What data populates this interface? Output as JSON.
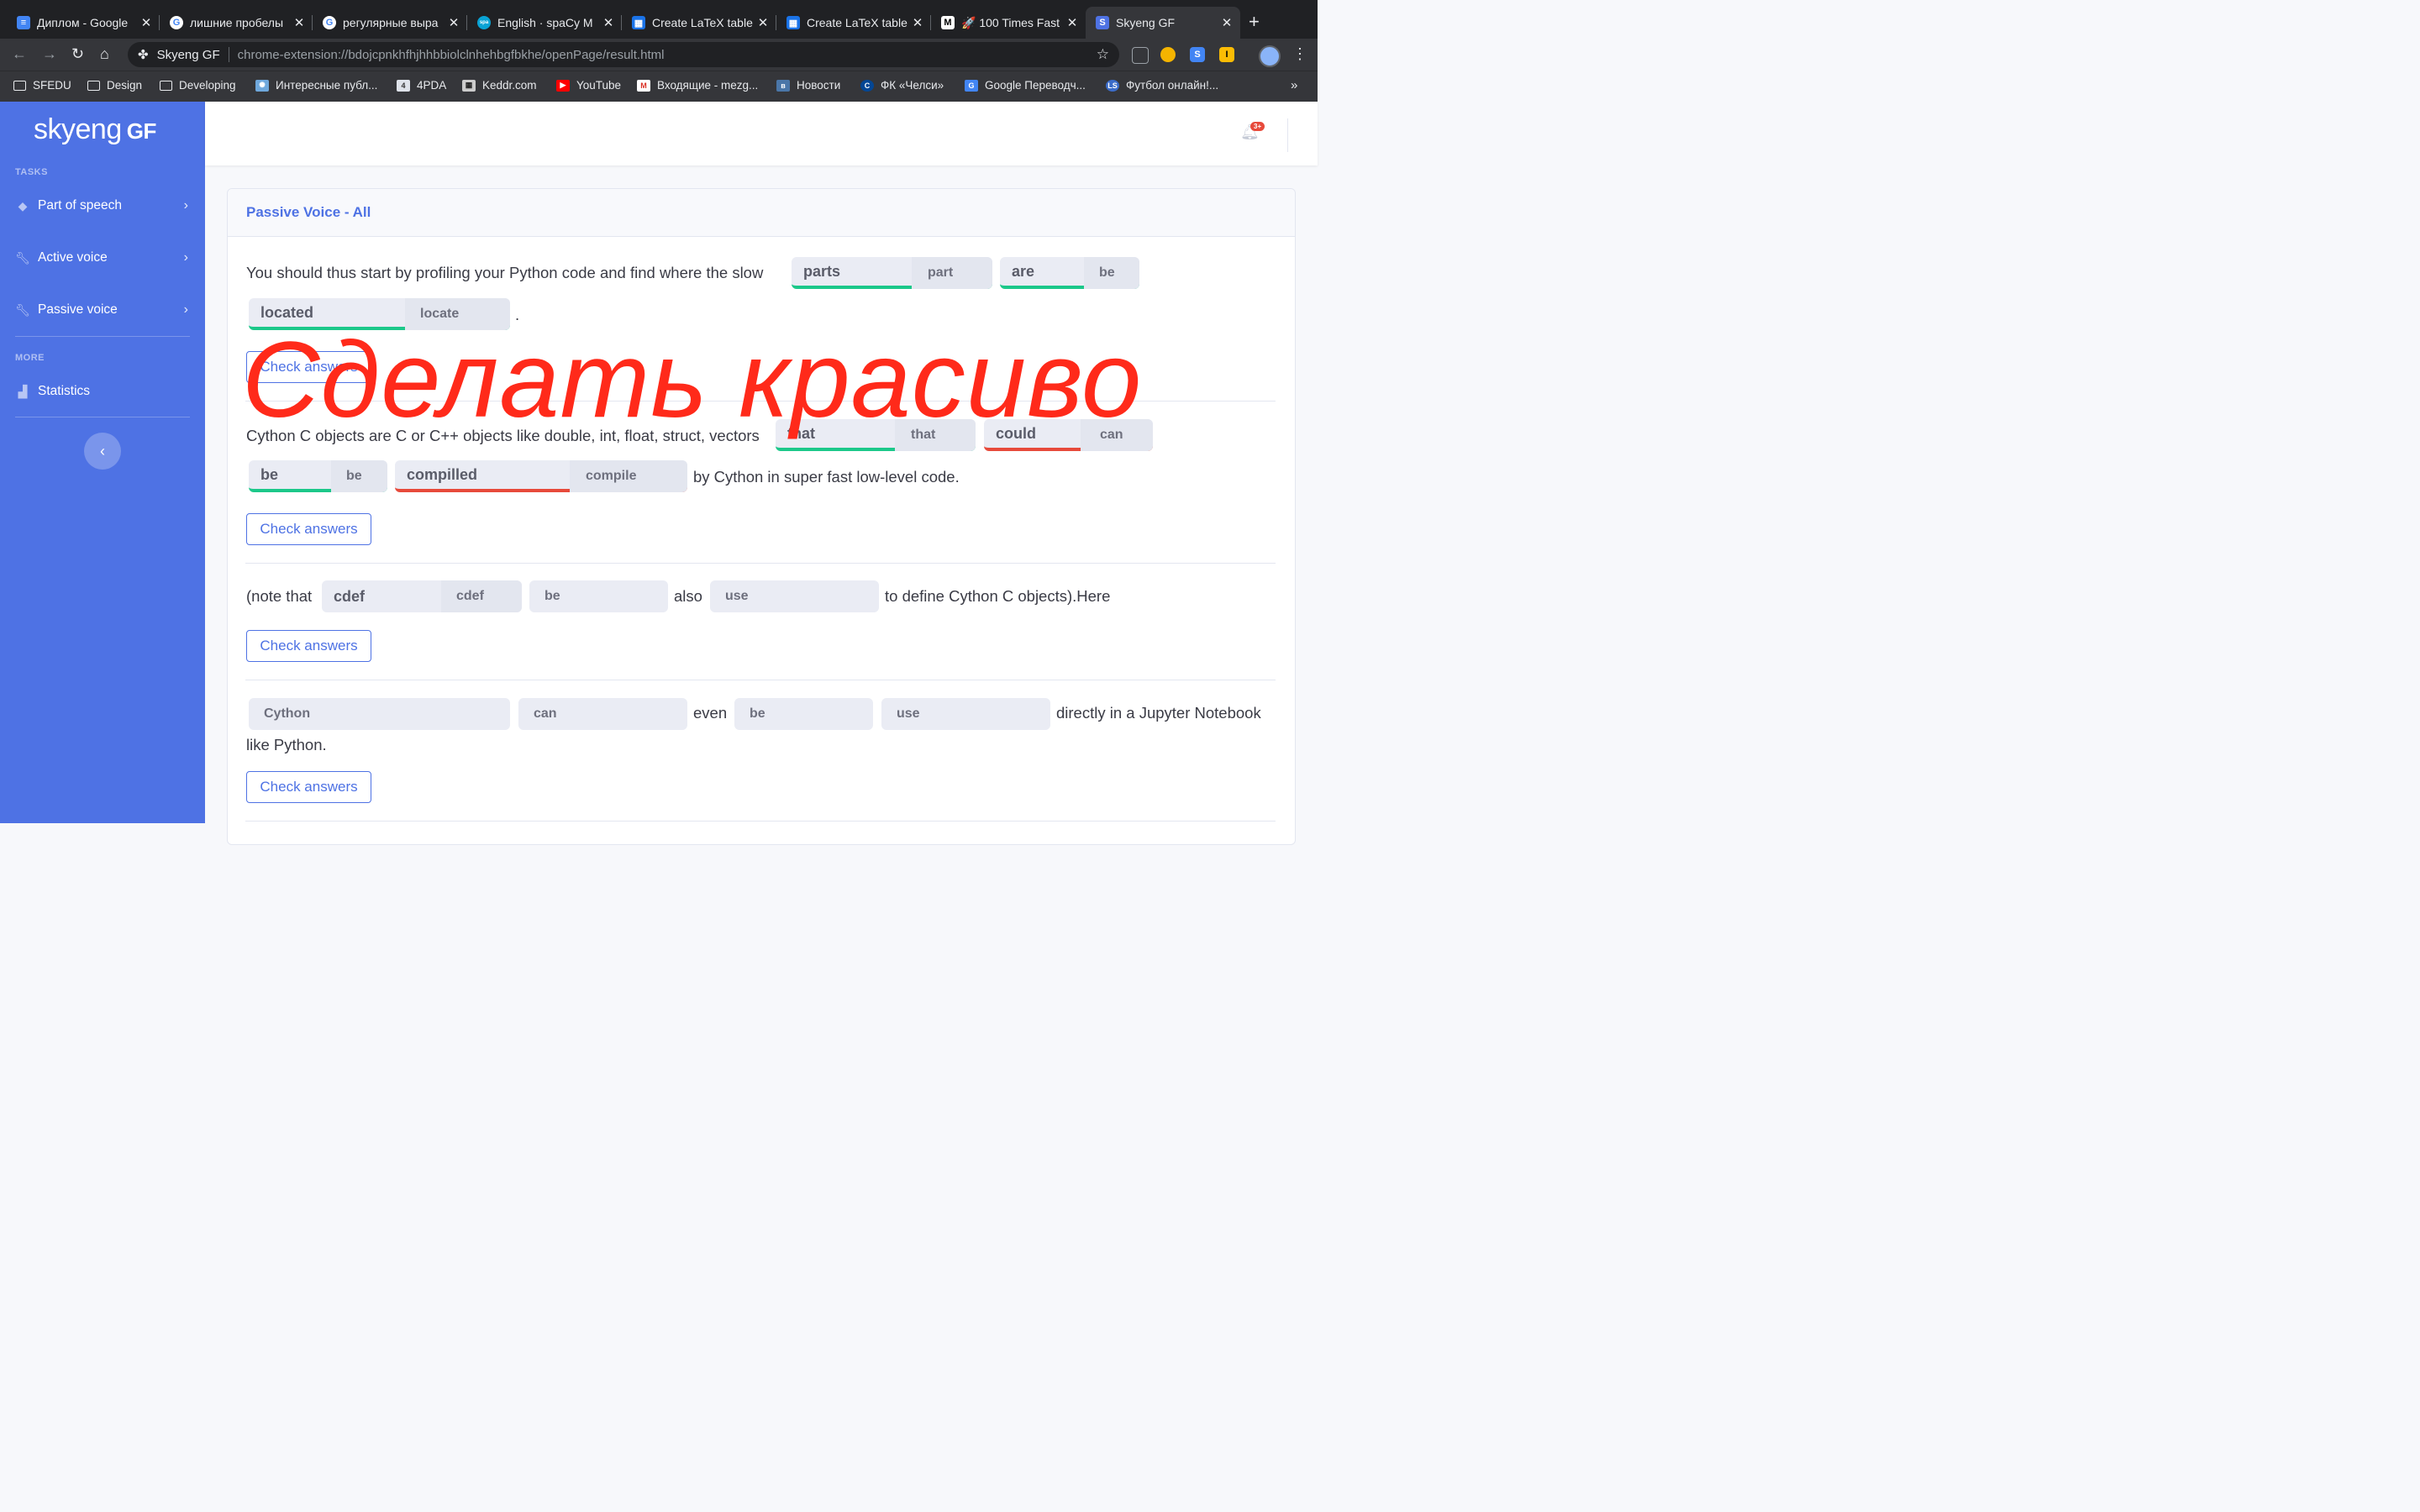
{
  "browser": {
    "tabs": [
      {
        "label": "Диплом - Google",
        "icon": "docs-icon",
        "color": "#4285f4"
      },
      {
        "label": "лишние пробелы",
        "icon": "google-icon",
        "color": "#ffffff"
      },
      {
        "label": "регулярные выра",
        "icon": "google-icon",
        "color": "#ffffff"
      },
      {
        "label": "English · spaCy M",
        "icon": "spacy-icon",
        "color": "#09a3d5"
      },
      {
        "label": "Create LaTeX table",
        "icon": "table-icon",
        "color": "#1a73e8"
      },
      {
        "label": "Create LaTeX table",
        "icon": "table-icon",
        "color": "#1a73e8"
      },
      {
        "label": "🚀 100 Times Fast",
        "icon": "medium-icon",
        "color": "#ffffff"
      },
      {
        "label": "Skyeng GF",
        "icon": "skyeng-icon",
        "color": "#4e72e4"
      }
    ],
    "url_origin": "Skyeng GF",
    "url_path": "chrome-extension://bdojcpnkhfhjhhbbiolclnhehbgfbkhe/openPage/result.html",
    "bookmarks": [
      {
        "label": "SFEDU",
        "icon": "folder-icon"
      },
      {
        "label": "Design",
        "icon": "folder-icon"
      },
      {
        "label": "Developing",
        "icon": "folder-icon"
      },
      {
        "label": "Интересные публ...",
        "icon": "bookmark-icon"
      },
      {
        "label": "4PDA",
        "icon": "bookmark-icon"
      },
      {
        "label": "Keddr.com",
        "icon": "bookmark-icon"
      },
      {
        "label": "YouTube",
        "icon": "youtube-icon"
      },
      {
        "label": "Входящие - mezg...",
        "icon": "gmail-icon"
      },
      {
        "label": "Новости",
        "icon": "vk-icon"
      },
      {
        "label": "ФК «Челси»",
        "icon": "chelsea-icon"
      },
      {
        "label": "Google Переводч...",
        "icon": "translate-icon"
      },
      {
        "label": "Футбол онлайн!...",
        "icon": "bookmark-icon"
      }
    ],
    "bookmarks_more": "»"
  },
  "sidebar": {
    "logo_text": "skyeng",
    "logo_suffix": "GF",
    "tasks_header": "TASKS",
    "items": [
      {
        "label": "Part of speech",
        "icon": "shapes-icon"
      },
      {
        "label": "Active voice",
        "icon": "wrench-icon"
      },
      {
        "label": "Passive voice",
        "icon": "wrench-icon"
      }
    ],
    "more_header": "MORE",
    "statistics_label": "Statistics",
    "collapse_glyph": "‹"
  },
  "header": {
    "notification_badge": "3+"
  },
  "card": {
    "title": "Passive Voice - All",
    "check_label": "Check answers",
    "ex1": {
      "text_before": "You should thus start by profiling your Python code and find where the slow",
      "blanks": [
        {
          "answer": "parts",
          "hint": "part",
          "status": "correct"
        },
        {
          "answer": "are",
          "hint": "be",
          "status": "correct"
        },
        {
          "answer": "located",
          "hint": "locate",
          "status": "correct"
        }
      ],
      "text_after": "."
    },
    "ex2": {
      "text_before": "Cython C objects are C or C++ objects like double, int, float, struct, vectors",
      "blanks": [
        {
          "answer": "that",
          "hint": "that",
          "status": "correct"
        },
        {
          "answer": "could",
          "hint": "can",
          "status": "wrong"
        },
        {
          "answer": "be",
          "hint": "be",
          "status": "correct"
        },
        {
          "answer": "compilled",
          "hint": "compile",
          "status": "wrong"
        }
      ],
      "text_after": "by Cython in super fast low-level code."
    },
    "ex3": {
      "text_before": "(note that",
      "blanks": [
        {
          "answer": "cdef",
          "hint": "cdef"
        },
        {
          "placeholder": "be"
        },
        {
          "placeholder": "use"
        }
      ],
      "text_mid": "also",
      "text_after": "to define Cython C objects).Here"
    },
    "ex4": {
      "blanks": [
        {
          "placeholder": "Cython"
        },
        {
          "placeholder": "can"
        },
        {
          "placeholder": "be"
        },
        {
          "placeholder": "use"
        }
      ],
      "text_mid": "even",
      "text_after": "directly in a Jupyter Notebook",
      "text_line2": "like Python."
    }
  },
  "overlay_text": "Сделать красиво",
  "colors": {
    "brand": "#4e72e4",
    "correct": "#1cc88a",
    "wrong": "#e74a3b",
    "overlay": "#ff2a1a"
  }
}
